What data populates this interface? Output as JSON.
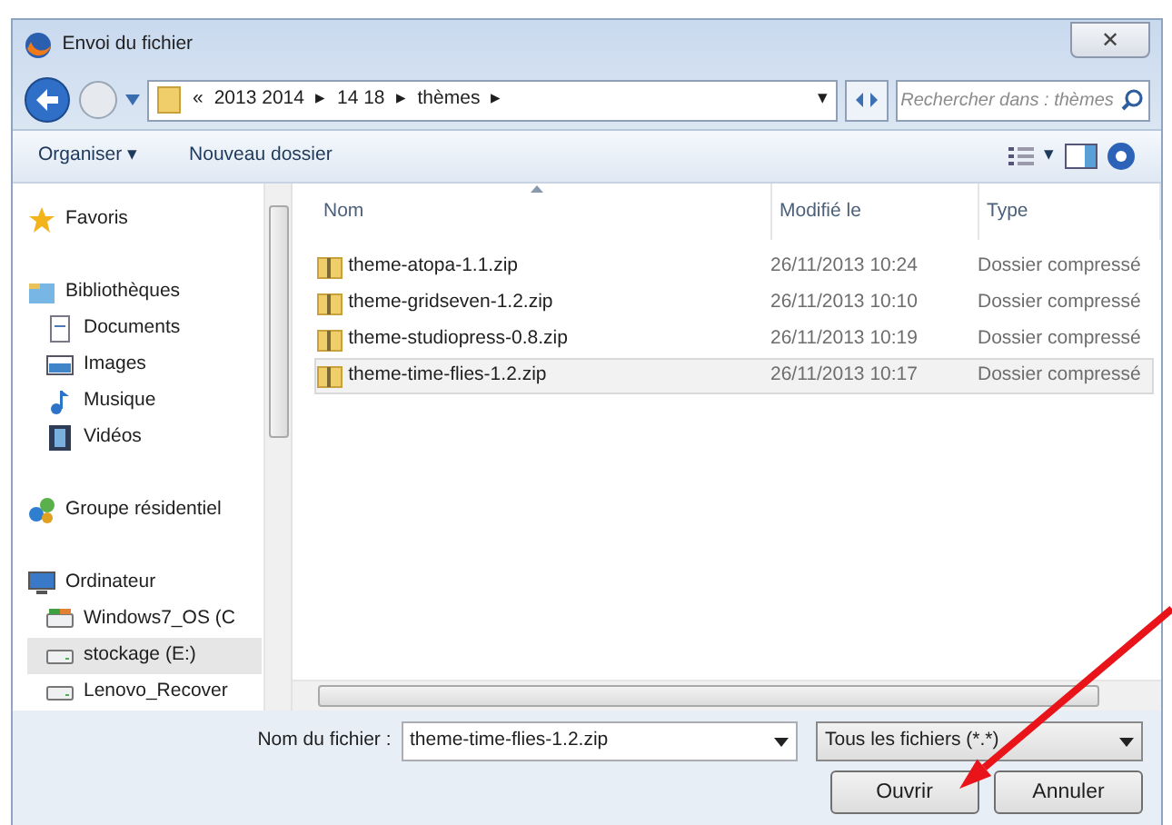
{
  "window": {
    "title": "Envoi du fichier",
    "close": "✕"
  },
  "address": {
    "prefix": "«",
    "crumbs": [
      "2013 2014",
      "14 18",
      "thèmes"
    ],
    "separator": "▸",
    "dropdown": "▾"
  },
  "search": {
    "placeholder": "Rechercher dans : thèmes"
  },
  "toolbar": {
    "organize": "Organiser ▾",
    "new_folder": "Nouveau dossier",
    "view_caret": "▾"
  },
  "sidebar": {
    "sections": [
      {
        "label": "Favoris",
        "selected": false
      },
      {
        "label": "Bibliothèques",
        "selected": false,
        "children": [
          {
            "label": "Documents",
            "selected": false
          },
          {
            "label": "Images",
            "selected": false
          },
          {
            "label": "Musique",
            "selected": false
          },
          {
            "label": "Vidéos",
            "selected": false
          }
        ]
      },
      {
        "label": "Groupe résidentiel",
        "selected": false
      },
      {
        "label": "Ordinateur",
        "selected": false,
        "children": [
          {
            "label": "Windows7_OS (C",
            "selected": false
          },
          {
            "label": "stockage (E:)",
            "selected": true
          },
          {
            "label": "Lenovo_Recover",
            "selected": false
          }
        ]
      }
    ]
  },
  "table": {
    "columns": [
      "Nom",
      "Modifié le",
      "Type"
    ],
    "rows": [
      {
        "name": "theme-atopa-1.1.zip",
        "modified": "26/11/2013 10:24",
        "type": "Dossier compressé",
        "selected": false
      },
      {
        "name": "theme-gridseven-1.2.zip",
        "modified": "26/11/2013 10:10",
        "type": "Dossier compressé",
        "selected": false
      },
      {
        "name": "theme-studiopress-0.8.zip",
        "modified": "26/11/2013 10:19",
        "type": "Dossier compressé",
        "selected": false
      },
      {
        "name": "theme-time-flies-1.2.zip",
        "modified": "26/11/2013 10:17",
        "type": "Dossier compressé",
        "selected": true
      }
    ]
  },
  "filename": {
    "label": "Nom du fichier :",
    "value": "theme-time-flies-1.2.zip"
  },
  "filter": {
    "value": "Tous les fichiers (*.*)"
  },
  "buttons": [
    "Ouvrir",
    "Annuler"
  ]
}
